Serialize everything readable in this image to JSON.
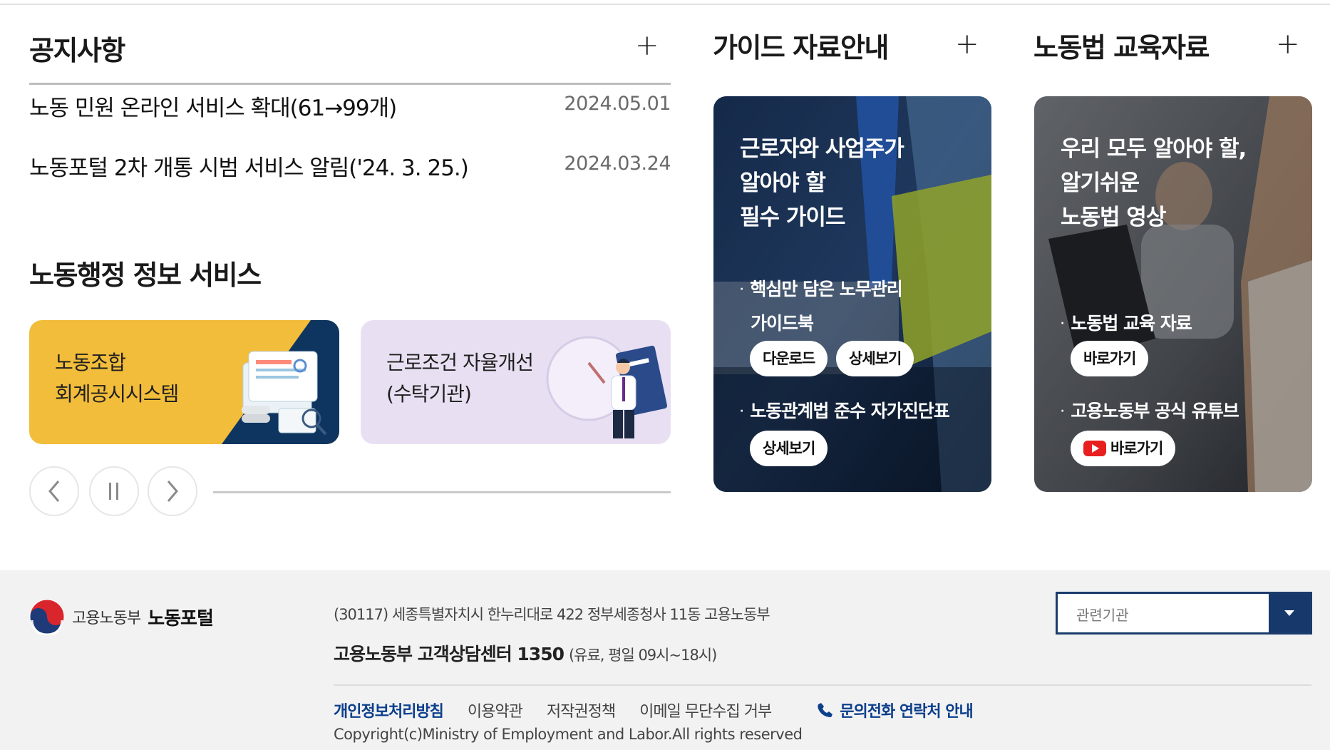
{
  "notice": {
    "title": "공지사항",
    "more": "+",
    "items": [
      {
        "title": "노동 민원 온라인 서비스 확대(61→99개)",
        "date": "2024.05.01"
      },
      {
        "title": "노동포털 2차 개통 시범 서비스 알림('24. 3. 25.)",
        "date": "2024.03.24"
      }
    ]
  },
  "services": {
    "title": "노동행정 정보 서비스",
    "cards": [
      {
        "line1": "노동조합",
        "line2": "회계공시시스템"
      },
      {
        "line1": "근로조건 자율개선",
        "line2": "(수탁기관)"
      }
    ],
    "controls": {
      "prev": "‹",
      "pause": "II",
      "next": "›"
    },
    "colors": {
      "card1_yellow": "#f2bd3a",
      "card1_navy": "#0d3560",
      "card2": "#e8e0f2"
    }
  },
  "guide": {
    "title": "가이드 자료안내",
    "more": "+",
    "heading": [
      "근로자와 사업주가",
      "알아야 할",
      "필수 가이드"
    ],
    "items": [
      {
        "label_line1": "핵심만 담은 노무관리",
        "label_line2": "가이드북",
        "buttons": [
          "다운로드",
          "상세보기"
        ]
      },
      {
        "label_line1": "노동관계법 준수 자가진단표",
        "buttons": [
          "상세보기"
        ]
      }
    ]
  },
  "edu": {
    "title": "노동법 교육자료",
    "more": "+",
    "heading": [
      "우리 모두 알아야 할,",
      "알기쉬운",
      "노동법 영상"
    ],
    "items": [
      {
        "label": "노동법 교육 자료",
        "button": "바로가기"
      },
      {
        "label": "고용노동부 공식 유튜브",
        "button": "바로가기",
        "icon": "youtube-icon"
      }
    ]
  },
  "footer": {
    "org": "고용노동부",
    "portal": "노동포털",
    "address": "(30117) 세종특별자치시 한누리대로 422 정부세종청사 11동 고용노동부",
    "center_label": "고용노동부 고객상담센터 1350",
    "center_hours": "(유료, 평일 09시~18시)",
    "links": [
      "개인정보처리방침",
      "이용약관",
      "저작권정책",
      "이메일 무단수집 거부"
    ],
    "call_link": "문의전화 연락처 안내",
    "copyright": "Copyright(c)Ministry of Employment and Labor.All rights reserved",
    "select_placeholder": "관련기관",
    "colors": {
      "navy": "#17386a",
      "link_blue": "#0c3f8c"
    }
  }
}
